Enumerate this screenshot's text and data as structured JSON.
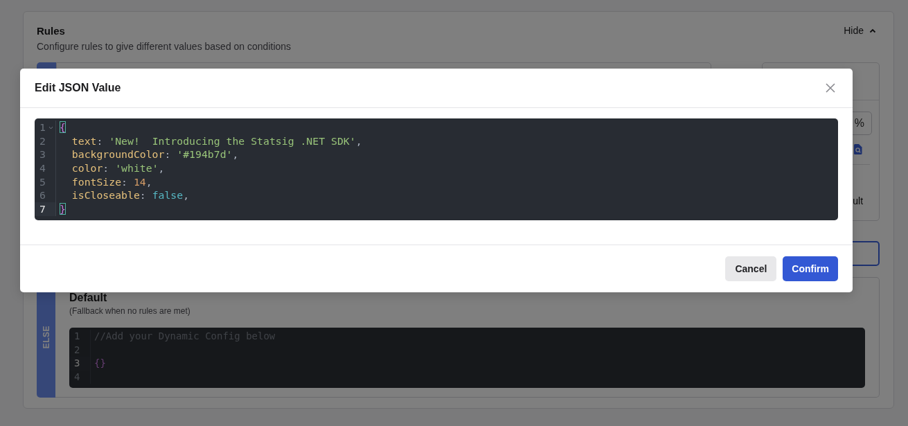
{
  "page": {
    "section": {
      "title": "Rules",
      "subtitle": "Configure rules to give different values based on conditions",
      "toggle": {
        "label": "Hide",
        "expanded": true
      }
    },
    "rule": {
      "side_panel": {
        "value_suffix": "%",
        "text_fragment": "ult"
      }
    },
    "default_rule": {
      "tab_label": "ELSE",
      "title": "Default",
      "subtitle": "(Fallback when no rules are met)",
      "editor": {
        "lines": [
          {
            "number": "1",
            "active": false,
            "foldable": false,
            "tokens": [
              {
                "kind": "comment",
                "text": "//Add your Dynamic Config below"
              }
            ]
          },
          {
            "number": "2",
            "active": false,
            "foldable": false
          },
          {
            "number": "3",
            "active": true,
            "foldable": false,
            "tokens": [
              {
                "kind": "bracket",
                "text": "{}",
                "matched": false
              }
            ]
          },
          {
            "number": "4",
            "active": false,
            "foldable": false
          }
        ]
      }
    }
  },
  "modal": {
    "title": "Edit JSON Value",
    "editor": {
      "lines": [
        {
          "number": "1",
          "active": false,
          "foldable": true,
          "tokens": [
            {
              "kind": "bracket",
              "text": "{",
              "matched": true
            }
          ]
        },
        {
          "number": "2",
          "active": false,
          "foldable": false,
          "indent": true,
          "tokens": [
            {
              "kind": "key",
              "text": "text"
            },
            {
              "kind": "punct",
              "text": ": "
            },
            {
              "kind": "string",
              "text": "'New!  Introducing the Statsig .NET SDK'"
            },
            {
              "kind": "punct",
              "text": ","
            }
          ]
        },
        {
          "number": "3",
          "active": false,
          "foldable": false,
          "indent": true,
          "tokens": [
            {
              "kind": "key",
              "text": "backgroundColor"
            },
            {
              "kind": "punct",
              "text": ": "
            },
            {
              "kind": "string",
              "text": "'#194b7d'"
            },
            {
              "kind": "punct",
              "text": ","
            }
          ]
        },
        {
          "number": "4",
          "active": false,
          "foldable": false,
          "indent": true,
          "tokens": [
            {
              "kind": "key",
              "text": "color"
            },
            {
              "kind": "punct",
              "text": ": "
            },
            {
              "kind": "string",
              "text": "'white'"
            },
            {
              "kind": "punct",
              "text": ","
            }
          ]
        },
        {
          "number": "5",
          "active": false,
          "foldable": false,
          "indent": true,
          "tokens": [
            {
              "kind": "key",
              "text": "fontSize"
            },
            {
              "kind": "punct",
              "text": ": "
            },
            {
              "kind": "number",
              "text": "14"
            },
            {
              "kind": "punct",
              "text": ","
            }
          ]
        },
        {
          "number": "6",
          "active": false,
          "foldable": false,
          "indent": true,
          "tokens": [
            {
              "kind": "key",
              "text": "isCloseable"
            },
            {
              "kind": "punct",
              "text": ": "
            },
            {
              "kind": "keyword",
              "text": "false"
            },
            {
              "kind": "punct",
              "text": ","
            }
          ]
        },
        {
          "number": "7",
          "active": true,
          "foldable": false,
          "tokens": [
            {
              "kind": "bracket",
              "text": "}",
              "matched": true
            }
          ]
        }
      ]
    },
    "buttons": [
      {
        "label": "Cancel",
        "kind": "secondary"
      },
      {
        "label": "Confirm",
        "kind": "primary"
      }
    ]
  }
}
